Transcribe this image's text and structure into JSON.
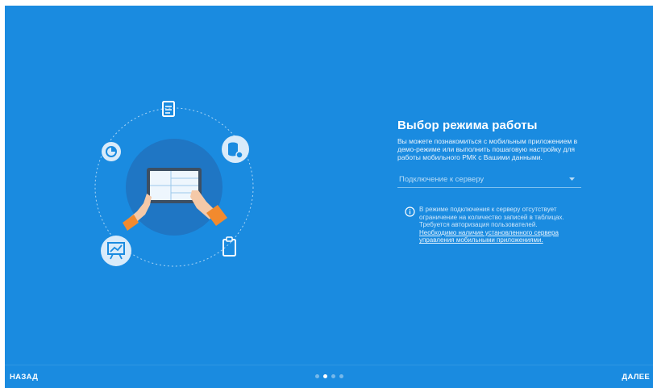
{
  "main": {
    "title": "Выбор режима работы",
    "description": "Вы можете познакомиться с мобильным приложением в демо-режиме или выполнить пошаговую настройку для работы мобильного РМК с Вашими данными.",
    "mode_select": {
      "selected": "Подключение к серверу",
      "icon": "chevron-down-icon"
    },
    "note": {
      "icon": "info-icon",
      "text": "В режиме подключения к серверу отсутствует ограничение на количество записей в таблицах. Требуется авторизация пользователей.",
      "link": "Необходимо наличие установленного сервера управления мобильными приложениями."
    }
  },
  "illustration": {
    "icons": [
      "document-icon",
      "database-settings-icon",
      "clipboard-icon",
      "presentation-chart-icon",
      "analytics-icon"
    ]
  },
  "footer": {
    "back_label": "НАЗАД",
    "next_label": "ДАЛЕЕ",
    "pagination": {
      "total": 4,
      "active": 2
    }
  },
  "colors": {
    "background": "#1a8be0",
    "circle": "#1f76c4",
    "accent": "#ffffff"
  }
}
